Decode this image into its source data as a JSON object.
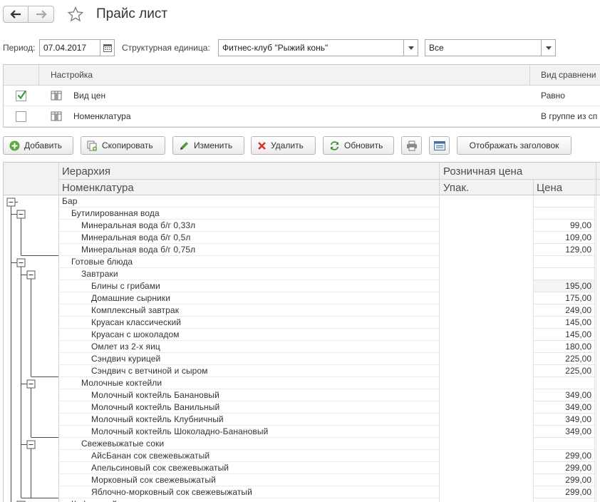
{
  "window": {
    "title": "Прайс лист"
  },
  "filters": {
    "period_label": "Период:",
    "period_value": "07.04.2017",
    "unit_label": "Структурная единица:",
    "unit_value": "Фитнес-клуб \"Рыжий конь\"",
    "scope_value": "Все"
  },
  "settings": {
    "headers": {
      "setting": "Настройка",
      "comparison": "Вид сравнени"
    },
    "rows": [
      {
        "label": "Вид цен",
        "checked": true,
        "comparison": "Равно"
      },
      {
        "label": "Номенклатура",
        "checked": false,
        "comparison": "В группе из сп"
      }
    ]
  },
  "toolbar": {
    "add": "Добавить",
    "copy": "Скопировать",
    "edit": "Изменить",
    "delete": "Удалить",
    "refresh": "Обновить",
    "print_icon": "printer-icon",
    "layout_icon": "form-layout-icon",
    "show_header": "Отображать заголовок"
  },
  "grid": {
    "headers": {
      "hierarchy": "Иерархия",
      "nomenclature": "Номенклатура",
      "retail_price": "Розничная цена",
      "pack": "Упак.",
      "price": "Цена"
    },
    "rows": [
      {
        "level": 0,
        "type": "group",
        "name": "Бар",
        "price": ""
      },
      {
        "level": 1,
        "type": "group",
        "name": "Бутилированная вода",
        "price": ""
      },
      {
        "level": 2,
        "type": "item",
        "name": "Минеральная вода б/г 0,33л",
        "price": "99,00"
      },
      {
        "level": 2,
        "type": "item",
        "name": "Минеральная вода б/г 0,5л",
        "price": "109,00"
      },
      {
        "level": 2,
        "type": "item",
        "name": "Минеральная вода б/г 0,75л",
        "price": "129,00"
      },
      {
        "level": 1,
        "type": "group",
        "name": "Готовые блюда",
        "price": ""
      },
      {
        "level": 2,
        "type": "group",
        "name": "Завтраки",
        "price": ""
      },
      {
        "level": 3,
        "type": "item",
        "name": "Блины с грибами",
        "price": "195,00",
        "selected": true
      },
      {
        "level": 3,
        "type": "item",
        "name": "Домашние сырники",
        "price": "175,00"
      },
      {
        "level": 3,
        "type": "item",
        "name": "Комплексный завтрак",
        "price": "249,00"
      },
      {
        "level": 3,
        "type": "item",
        "name": "Круасан классический",
        "price": "145,00"
      },
      {
        "level": 3,
        "type": "item",
        "name": "Круасан с шоколадом",
        "price": "145,00"
      },
      {
        "level": 3,
        "type": "item",
        "name": "Омлет из 2-х яиц",
        "price": "180,00"
      },
      {
        "level": 3,
        "type": "item",
        "name": "Сэндвич курицей",
        "price": "225,00"
      },
      {
        "level": 3,
        "type": "item",
        "name": "Сэндвич с ветчиной и сыром",
        "price": "225,00"
      },
      {
        "level": 2,
        "type": "group",
        "name": "Молочные коктейли",
        "price": ""
      },
      {
        "level": 3,
        "type": "item",
        "name": "Молочный коктейль Банановый",
        "price": "349,00"
      },
      {
        "level": 3,
        "type": "item",
        "name": "Молочный коктейль Ванильный",
        "price": "349,00"
      },
      {
        "level": 3,
        "type": "item",
        "name": "Молочный коктейль Клубничный",
        "price": "349,00"
      },
      {
        "level": 3,
        "type": "item",
        "name": "Молочный коктейль Шоколадно-Банановый",
        "price": "349,00"
      },
      {
        "level": 2,
        "type": "group",
        "name": "Свежевыжатые соки",
        "price": ""
      },
      {
        "level": 3,
        "type": "item",
        "name": "АйсБанан сок свежевыжатый",
        "price": "299,00"
      },
      {
        "level": 3,
        "type": "item",
        "name": "Апельсиновый сок свежевыжатый",
        "price": "299,00"
      },
      {
        "level": 3,
        "type": "item",
        "name": "Морковный сок свежевыжатый",
        "price": "299,00"
      },
      {
        "level": 3,
        "type": "item",
        "name": "Яблочно-морковный сок свежевыжатый",
        "price": "299,00"
      },
      {
        "level": 1,
        "type": "group",
        "name": "Кофе и чай",
        "price": ""
      }
    ]
  },
  "colors": {
    "header_bg": "#f2f2f2",
    "border": "#c8c8c8",
    "check_green": "#3a9a3a",
    "text": "#333333"
  }
}
